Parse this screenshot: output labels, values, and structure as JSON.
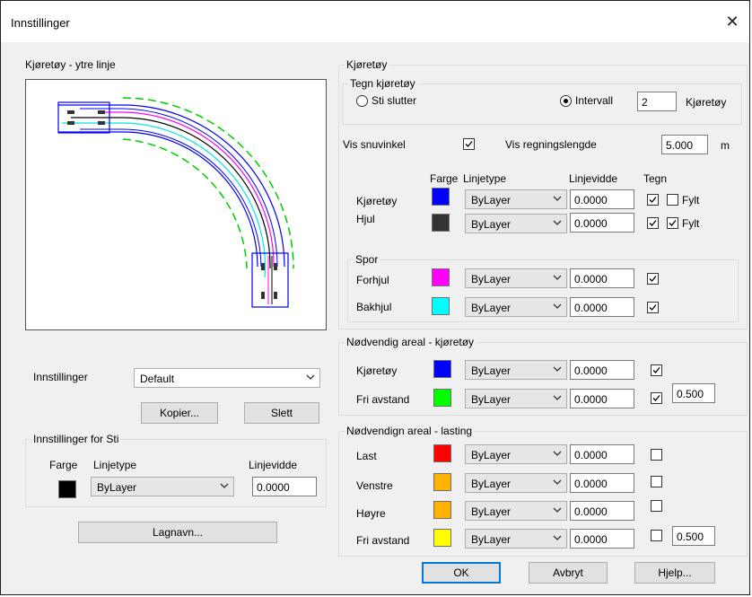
{
  "window": {
    "title": "Innstillinger",
    "close_glyph": "✕"
  },
  "preview": {
    "label": "Kjøretøy - ytre linje"
  },
  "settings": {
    "label": "Innstillinger",
    "value": "Default",
    "copy_button": "Kopier...",
    "delete_button": "Slett"
  },
  "path_settings": {
    "caption": "Innstillinger for Sti",
    "color_header": "Farge",
    "linetype_header": "Linjetype",
    "linewidth_header": "Linjevidde",
    "color": "#000000",
    "linetype": "ByLayer",
    "linewidth": "0.0000"
  },
  "layer_button": "Lagnavn...",
  "vehicle": {
    "caption": "Kjøretøy",
    "draw_caption": "Tegn kjøretøy",
    "radio_end_label": "Sti slutter",
    "radio_end_selected": false,
    "radio_interval_label": "Intervall",
    "radio_interval_selected": true,
    "interval_value": "2",
    "interval_unit": "Kjøretøy",
    "show_turn_angle_label": "Vis snuvinkel",
    "show_turn_angle_checked": true,
    "show_calc_length_label": "Vis regningslengde",
    "calc_length_value": "5.000",
    "calc_length_unit": "m",
    "headers": {
      "color": "Farge",
      "linetype": "Linjetype",
      "linewidth": "Linjevidde",
      "draw": "Tegn"
    },
    "rows": [
      {
        "label": "Kjøretøy",
        "color": "#0000ff",
        "linetype": "ByLayer",
        "linewidth": "0.0000",
        "draw": true,
        "filled_label": "Fylt",
        "filled": false
      },
      {
        "label": "Hjul",
        "color": "#333333",
        "linetype": "ByLayer",
        "linewidth": "0.0000",
        "draw": true,
        "filled_label": "Fylt",
        "filled": true
      }
    ]
  },
  "tracks": {
    "caption": "Spor",
    "rows": [
      {
        "label": "Forhjul",
        "color": "#ff00ff",
        "linetype": "ByLayer",
        "linewidth": "0.0000",
        "draw": true
      },
      {
        "label": "Bakhjul",
        "color": "#00ffff",
        "linetype": "ByLayer",
        "linewidth": "0.0000",
        "draw": true
      }
    ]
  },
  "required_area_vehicle": {
    "caption": "Nødvendig areal - kjøretøy",
    "rows": [
      {
        "label": "Kjøretøy",
        "color": "#0000ff",
        "linetype": "ByLayer",
        "linewidth": "0.0000",
        "draw": true
      },
      {
        "label": "Fri avstand",
        "color": "#00ff00",
        "linetype": "ByLayer",
        "linewidth": "0.0000",
        "draw": true,
        "extra": "0.500"
      }
    ]
  },
  "required_area_load": {
    "caption": "Nødvendign areal - lasting",
    "rows": [
      {
        "label": "Last",
        "color": "#ff0000",
        "linetype": "ByLayer",
        "linewidth": "0.0000",
        "draw": false
      },
      {
        "label": "Venstre",
        "color": "#ffb300",
        "linetype": "ByLayer",
        "linewidth": "0.0000",
        "draw": false
      },
      {
        "label": "Høyre",
        "color": "#ffb300",
        "linetype": "ByLayer",
        "linewidth": "0.0000",
        "draw": false
      },
      {
        "label": "Fri avstand",
        "color": "#ffff00",
        "linetype": "ByLayer",
        "linewidth": "0.0000",
        "draw": false,
        "extra": "0.500"
      }
    ]
  },
  "buttons": {
    "ok": "OK",
    "cancel": "Avbryt",
    "help": "Hjelp..."
  }
}
